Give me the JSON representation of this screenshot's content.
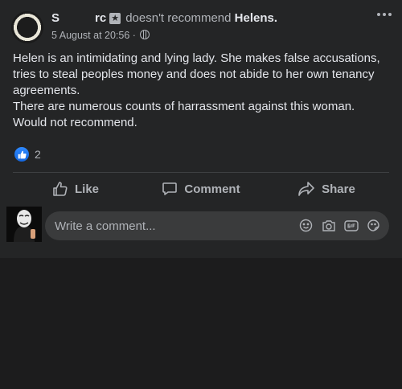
{
  "post": {
    "author_first": "S",
    "author_last": "rc",
    "recommend_text": "doesn't recommend",
    "page_name": "Helens.",
    "timestamp": "5 August at 20:56",
    "meta_separator": "·",
    "paragraphs": [
      "Helen is an intimidating and lying lady. She makes false accusations, tries to steal peoples money and does not abide to her own tenancy agreements.",
      "There are numerous counts of harrassment against this woman.",
      "Would not recommend."
    ],
    "reaction_count": "2"
  },
  "actions": {
    "like_label": "Like",
    "comment_label": "Comment",
    "share_label": "Share"
  },
  "comment_box": {
    "placeholder": "Write a comment..."
  },
  "colors": {
    "card_bg": "#242526",
    "page_bg": "#1c1c1d",
    "primary_text": "#e4e6eb",
    "secondary_text": "#b0b3b8",
    "like_blue": "#2e89ff"
  }
}
